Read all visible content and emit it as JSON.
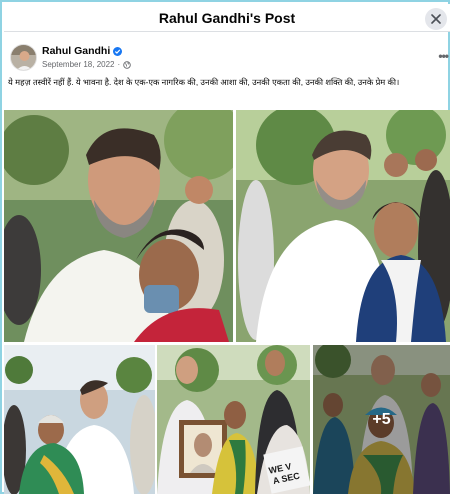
{
  "header": {
    "title": "Rahul Gandhi's Post"
  },
  "post": {
    "author": "Rahul Gandhi",
    "date": "September 18, 2022",
    "separator": "·",
    "caption": "ये महज़ तस्वीरें नहीं हैं. ये भावना है. देश के एक-एक नागरिक की, उनकी आशा की, उनकी एकता की, उनकी शक्ति की, उनके प्रेम की।"
  },
  "photos": {
    "more_count": "+5"
  },
  "poster_text": "WE V\nA SEC\nIN"
}
